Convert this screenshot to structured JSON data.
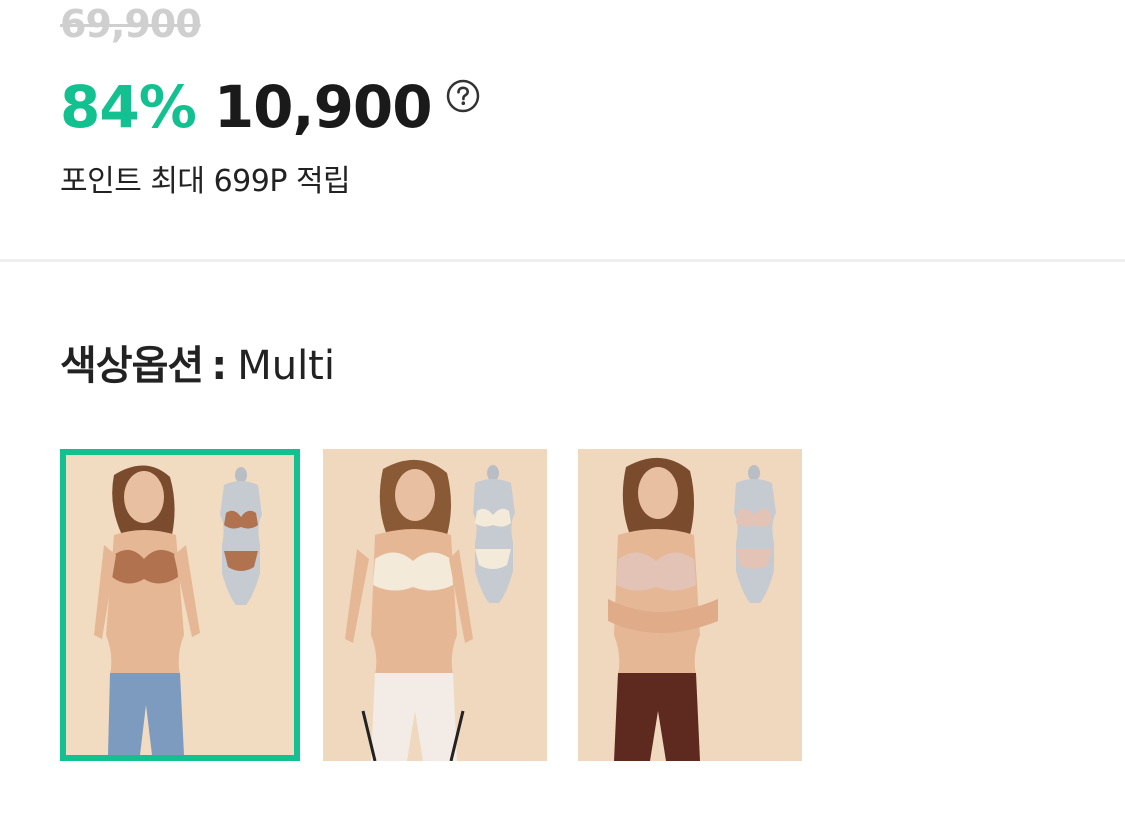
{
  "price": {
    "original": "69,900",
    "discount_percent": "84%",
    "sale_price": "10,900",
    "help_icon": "question-circle-icon"
  },
  "points": {
    "text": "포인트 최대 699P 적립"
  },
  "color_option": {
    "label": "색상옵션",
    "separator": ":",
    "value": "Multi",
    "selected_index": 0,
    "swatches": [
      {
        "name": "Brown set with jeans",
        "bra_color": "#b0724f",
        "bottom_color": "#7d9bbf",
        "selected": true
      },
      {
        "name": "Ivory set with white leggings",
        "bra_color": "#f3ead9",
        "bottom_color": "#f3ece6",
        "selected": false
      },
      {
        "name": "Pink set with brown leggings",
        "bra_color": "#e3c3b6",
        "bottom_color": "#5e2a1f",
        "selected": false
      }
    ]
  },
  "colors": {
    "accent": "#12c18f",
    "strike": "#cfcfcf",
    "text": "#1a1a1a",
    "divider": "#eeeeee",
    "photo_bg": "#efd8bd"
  }
}
